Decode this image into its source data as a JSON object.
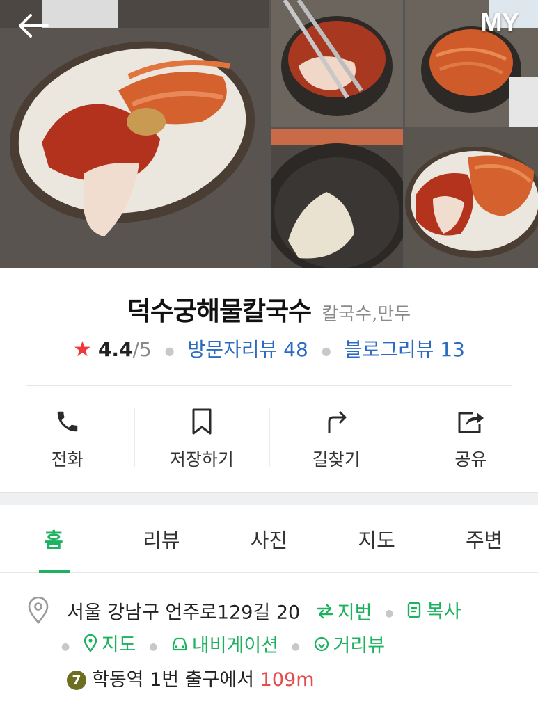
{
  "header": {
    "back_icon": "arrow-left-icon",
    "my_label": "MY"
  },
  "photos": [
    {
      "subject": "kimchi-plate"
    },
    {
      "subject": "kimchi-pot-tongs"
    },
    {
      "subject": "radish-pot"
    },
    {
      "subject": "rice-bowl"
    },
    {
      "subject": "kimchi-plate-2"
    }
  ],
  "place": {
    "name": "덕수궁해물칼국수",
    "category": "칼국수,만두",
    "rating": "4.4",
    "rating_max": "/5",
    "visitor_review_label": "방문자리뷰 48",
    "blog_review_label": "블로그리뷰 13"
  },
  "actions": [
    {
      "label": "전화",
      "icon": "phone-icon"
    },
    {
      "label": "저장하기",
      "icon": "bookmark-icon"
    },
    {
      "label": "길찾기",
      "icon": "directions-icon"
    },
    {
      "label": "공유",
      "icon": "share-icon"
    }
  ],
  "tabs": [
    {
      "label": "홈",
      "active": true
    },
    {
      "label": "리뷰"
    },
    {
      "label": "사진"
    },
    {
      "label": "지도"
    },
    {
      "label": "주변"
    }
  ],
  "address": {
    "text": "서울 강남구 언주로129길 20",
    "lot_number_label": "지번",
    "copy_label": "복사",
    "map_label": "지도",
    "navigation_label": "내비게이션",
    "street_view_label": "거리뷰",
    "subway_line": "7",
    "station_text": "학동역 1번 출구에서",
    "distance": "109m"
  },
  "colors": {
    "accent_green": "#1db160",
    "link_blue": "#2d6bc1",
    "star_red": "#f0373c",
    "distance_red": "#e24d4d",
    "line7_olive": "#6d6e22"
  }
}
